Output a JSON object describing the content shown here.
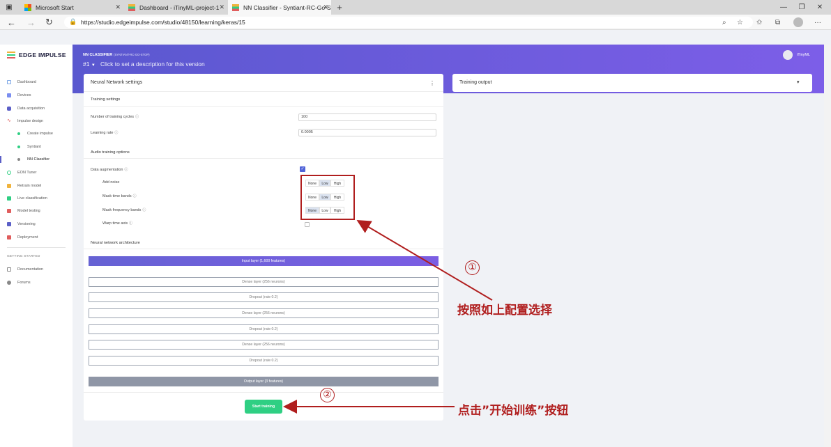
{
  "browser": {
    "tabs": [
      {
        "title": "Microsoft Start"
      },
      {
        "title": "Dashboard - iTinyML-project-1"
      },
      {
        "title": "NN Classifier - Syntiant-RC-Go-S"
      }
    ],
    "url": "https://studio.edgeimpulse.com/studio/48150/learning/keras/15",
    "colors": {
      "tab_active": "#f7f7f7"
    }
  },
  "sidebar": {
    "logo_text": "EDGE IMPULSE",
    "items": [
      {
        "label": "Dashboard",
        "icon": "monitor-icon",
        "color": "#7aa5e6"
      },
      {
        "label": "Devices",
        "icon": "devices-icon",
        "color": "#7b8ef0"
      },
      {
        "label": "Data acquisition",
        "icon": "database-icon",
        "color": "#5b5fc7"
      },
      {
        "label": "Impulse design",
        "icon": "pulse-icon",
        "color": "#e05d5d"
      },
      {
        "label": "Create impulse",
        "icon": "dot-icon",
        "color": "#2fcf83"
      },
      {
        "label": "Syntiant",
        "icon": "dot-icon",
        "color": "#2fcf83"
      },
      {
        "label": "NN Classifier",
        "icon": "dot-icon",
        "color": "#888888"
      },
      {
        "label": "EON Tuner",
        "icon": "tuner-icon",
        "color": "#2fcf83"
      },
      {
        "label": "Retrain model",
        "icon": "retrain-icon",
        "color": "#f0b33c"
      },
      {
        "label": "Live classification",
        "icon": "live-icon",
        "color": "#2fcf83"
      },
      {
        "label": "Model testing",
        "icon": "testing-icon",
        "color": "#e05d5d"
      },
      {
        "label": "Versioning",
        "icon": "versioning-icon",
        "color": "#5b5fc7"
      },
      {
        "label": "Deployment",
        "icon": "deploy-icon",
        "color": "#e05d5d"
      }
    ],
    "getting_started": "GETTING STARTED",
    "help_items": [
      {
        "label": "Documentation",
        "icon": "docs-icon"
      },
      {
        "label": "Forums",
        "icon": "forums-icon"
      }
    ]
  },
  "header": {
    "title": "NN CLASSIFIER",
    "project": "(SYNTIANT-RC-GO-STOP)",
    "version": "#1",
    "description": "Click to set a description for this version",
    "user": "iTinyML"
  },
  "settings": {
    "card_title": "Neural Network settings",
    "training_settings": "Training settings",
    "cycles_label": "Number of training cycles",
    "cycles_value": "100",
    "lr_label": "Learning rate",
    "lr_value": "0.0005",
    "audio_options": "Audio training options",
    "augmentation_label": "Data augmentation",
    "augmentation_checked": true,
    "add_noise_label": "Add noise",
    "mask_time_label": "Mask time bands",
    "mask_freq_label": "Mask frequency bands",
    "warp_label": "Warp time axis",
    "warp_checked": false,
    "seg_options": [
      "None",
      "Low",
      "High"
    ],
    "add_noise_selected": "Low",
    "mask_time_selected": "Low",
    "mask_freq_selected": "None",
    "arch_title": "Neural network architecture",
    "layers": [
      {
        "label": "Input layer (1,600 features)",
        "kind": "input"
      },
      {
        "label": "Dense layer (256 neurons)",
        "kind": "hidden"
      },
      {
        "label": "Dropout (rate 0.2)",
        "kind": "hidden"
      },
      {
        "label": "Dense layer (256 neurons)",
        "kind": "hidden"
      },
      {
        "label": "Dropout (rate 0.2)",
        "kind": "hidden"
      },
      {
        "label": "Dense layer (256 neurons)",
        "kind": "hidden"
      },
      {
        "label": "Dropout (rate 0.2)",
        "kind": "hidden"
      },
      {
        "label": "Output layer (3 features)",
        "kind": "output"
      }
    ],
    "start_button": "Start training"
  },
  "output_card": {
    "title": "Training output"
  },
  "annotations": {
    "step1_mark": "①",
    "step1_text": "按照如上配置选择",
    "step2_mark": "②",
    "step2_text": "点击”开始训练”按钮",
    "color": "#b01e1e"
  }
}
